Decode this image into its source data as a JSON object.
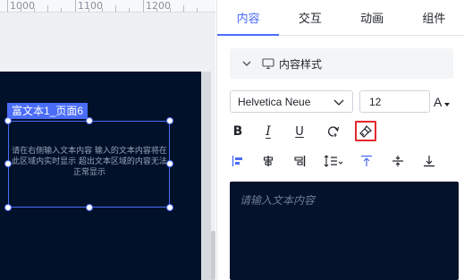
{
  "ruler": {
    "labels": [
      "1000",
      "1100",
      "1200"
    ]
  },
  "canvas": {
    "selected_label": "富文本1_页面6",
    "text_lines": [
      "请在右侧输入文本内容 输入的文本内容将在",
      "此区域内实时显示 超出文本区域的内容无法",
      "正常显示"
    ]
  },
  "panel": {
    "tabs": [
      {
        "label": "内容",
        "active": true
      },
      {
        "label": "交互",
        "active": false
      },
      {
        "label": "动画",
        "active": false
      },
      {
        "label": "组件",
        "active": false
      }
    ],
    "section": {
      "title": "内容样式"
    },
    "font_family": "Helvetica Neue",
    "font_size": "12",
    "color_button": "A",
    "editor_placeholder": "请输入文本内容"
  },
  "colors": {
    "accent": "#4a6cf7",
    "canvas_bg": "#02112a",
    "highlight": "#e5282e"
  },
  "icons": {
    "format_row": [
      "bold-icon",
      "italic-icon",
      "underline-icon",
      "clear-format-icon",
      "format-brush-icon"
    ],
    "align_row": [
      "align-left-icon",
      "align-center-icon",
      "align-right-icon",
      "line-height-icon",
      "align-top-icon",
      "align-middle-icon",
      "align-bottom-icon"
    ]
  }
}
